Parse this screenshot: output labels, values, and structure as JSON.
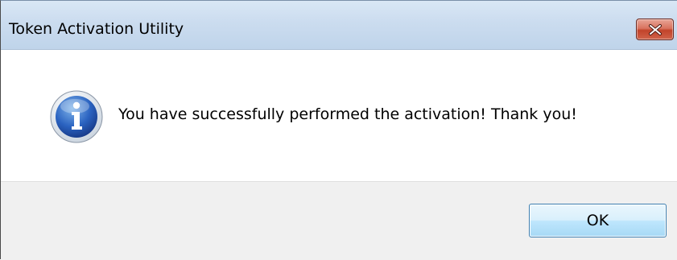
{
  "window": {
    "title": "Token Activation Utility"
  },
  "titlebar": {
    "close_icon": "close-icon"
  },
  "dialog": {
    "icon": "info-icon",
    "message": "You have successfully performed the activation! Thank you!"
  },
  "footer": {
    "ok_label": "OK"
  },
  "colors": {
    "titlebar": "#cbdcef",
    "close_button": "#c94a32",
    "footer": "#f0f0f0",
    "ok_button_border": "#3c7fb1"
  }
}
